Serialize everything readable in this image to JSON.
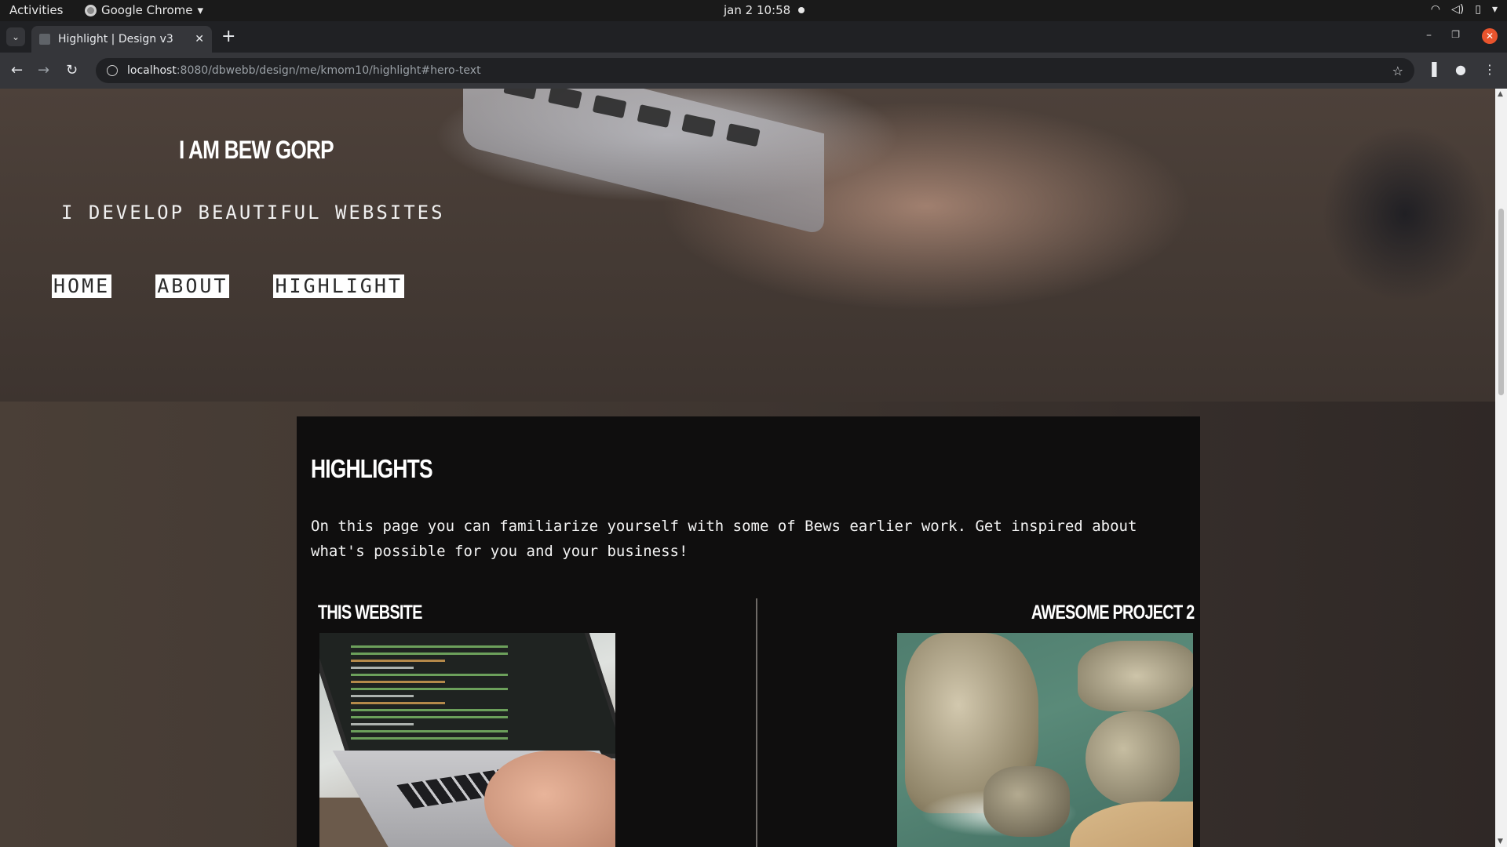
{
  "system_bar": {
    "activities": "Activities",
    "app_name": "Google Chrome",
    "clock": "jan 2  10:58"
  },
  "browser": {
    "tab_title": "Highlight | Design v3",
    "url_host": "localhost",
    "url_path": ":8080/dbwebb/design/me/kmom10/highlight#hero-text"
  },
  "hero": {
    "title": "I AM BEW GORP",
    "subtitle": "I DEVELOP BEAUTIFUL WEBSITES",
    "menu": [
      {
        "label": "HOME"
      },
      {
        "label": "ABOUT"
      },
      {
        "label": "HIGHLIGHT"
      }
    ]
  },
  "main": {
    "heading": "HIGHLIGHTS",
    "intro": "On this page you can familiarize yourself with some of Bews earlier work. Get inspired about what's possible for you and your business!",
    "projects": [
      {
        "title": "THIS WEBSITE"
      },
      {
        "title": "AWESOME PROJECT 2"
      }
    ]
  }
}
